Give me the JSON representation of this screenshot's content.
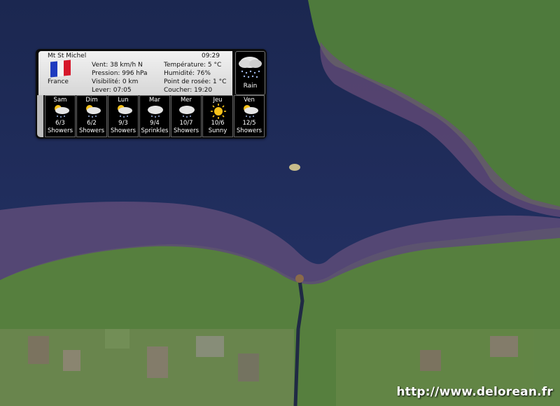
{
  "widget": {
    "location": "Mt St Michel",
    "time": "09:29",
    "country": "France",
    "wind": "Vent: 38 km/h N",
    "pressure": "Pression: 996 hPa",
    "visibility": "Visibilité: 0 km",
    "sunrise": "Lever: 07:05",
    "temperature": "Température: 5 °C",
    "humidity": "Humidité: 76%",
    "dewpoint": "Point de rosée: 1 °C",
    "sunset": "Coucher: 19:20",
    "current_condition": "Rain",
    "current_icon": "rain-cloud-icon"
  },
  "forecast": [
    {
      "day": "Sam",
      "temps": "6/3",
      "cond": "Showers",
      "icon": "showers-icon"
    },
    {
      "day": "Dim",
      "temps": "6/2",
      "cond": "Showers",
      "icon": "showers-icon"
    },
    {
      "day": "Lun",
      "temps": "9/3",
      "cond": "Showers",
      "icon": "showers-icon"
    },
    {
      "day": "Mar",
      "temps": "9/4",
      "cond": "Sprinkles",
      "icon": "sprinkles-icon"
    },
    {
      "day": "Mer",
      "temps": "10/7",
      "cond": "Showers",
      "icon": "showers-icon"
    },
    {
      "day": "Jeu",
      "temps": "10/6",
      "cond": "Sunny",
      "icon": "sun-icon"
    },
    {
      "day": "Ven",
      "temps": "12/5",
      "cond": "Showers",
      "icon": "showers-icon"
    }
  ],
  "watermark": "http://www.delorean.fr",
  "colors": {
    "flag_blue": "#1f3bbf",
    "flag_white": "#f4f4f4",
    "flag_red": "#d6182b",
    "sun": "#f6c21b"
  }
}
